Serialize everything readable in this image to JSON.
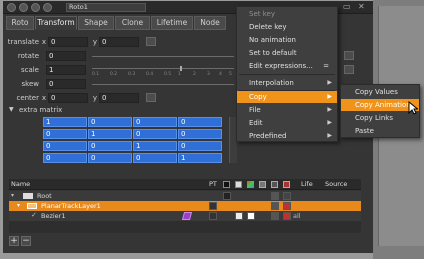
{
  "window": {
    "node_name": "Roto1"
  },
  "tabs": [
    "Roto",
    "Transform",
    "Shape",
    "Clone",
    "Lifetime",
    "Node"
  ],
  "transform": {
    "translate": {
      "label": "translate",
      "x_label": "x",
      "x": "0",
      "y_label": "y",
      "y": "0"
    },
    "rotate": {
      "label": "rotate",
      "value": "0"
    },
    "scale": {
      "label": "scale",
      "value": "1"
    },
    "skew": {
      "label": "skew",
      "value": "0"
    },
    "center": {
      "label": "center",
      "x_label": "x",
      "x": "0",
      "y_label": "y",
      "y": "0"
    },
    "slider_ticks": [
      "0.1",
      "0.2",
      "0.3",
      "0.4",
      "0.5",
      "1",
      "2",
      "3",
      "4",
      "5"
    ]
  },
  "extra_matrix": {
    "label": "extra matrix",
    "rows": [
      [
        "1",
        "0",
        "0",
        "0"
      ],
      [
        "0",
        "1",
        "0",
        "0"
      ],
      [
        "0",
        "0",
        "1",
        "0"
      ],
      [
        "0",
        "0",
        "0",
        "1"
      ]
    ]
  },
  "layers": {
    "headers": [
      "Name",
      "PT",
      "Life",
      "Source"
    ],
    "rows": [
      {
        "name": "Root",
        "life": ""
      },
      {
        "name": "PlanarTrackLayer1",
        "life": ""
      },
      {
        "name": "Bezier1",
        "life": "all"
      }
    ]
  },
  "context_menu": {
    "items": [
      {
        "label": "Set key",
        "disabled": true
      },
      {
        "label": "Delete key",
        "disabled": false
      },
      {
        "label": "No animation",
        "disabled": false
      },
      {
        "label": "Set to default",
        "disabled": false
      },
      {
        "label": "Edit expressions...",
        "shortcut": "=",
        "disabled": false
      },
      {
        "label": "Interpolation",
        "submenu": true
      },
      {
        "label": "Copy",
        "submenu": true,
        "highlighted": true
      },
      {
        "label": "File",
        "submenu": true
      },
      {
        "label": "Edit",
        "submenu": true
      },
      {
        "label": "Predefined",
        "submenu": true
      }
    ]
  },
  "copy_submenu": {
    "items": [
      {
        "label": "Copy Values",
        "highlighted": false
      },
      {
        "label": "Copy Animation",
        "highlighted": true
      },
      {
        "label": "Copy Links",
        "highlighted": false
      },
      {
        "label": "Paste",
        "highlighted": false
      }
    ]
  },
  "colors": {
    "accent_orange": "#f0931b",
    "matrix_blue": "#2f6fd7",
    "layer_selected": "#e8891c"
  }
}
